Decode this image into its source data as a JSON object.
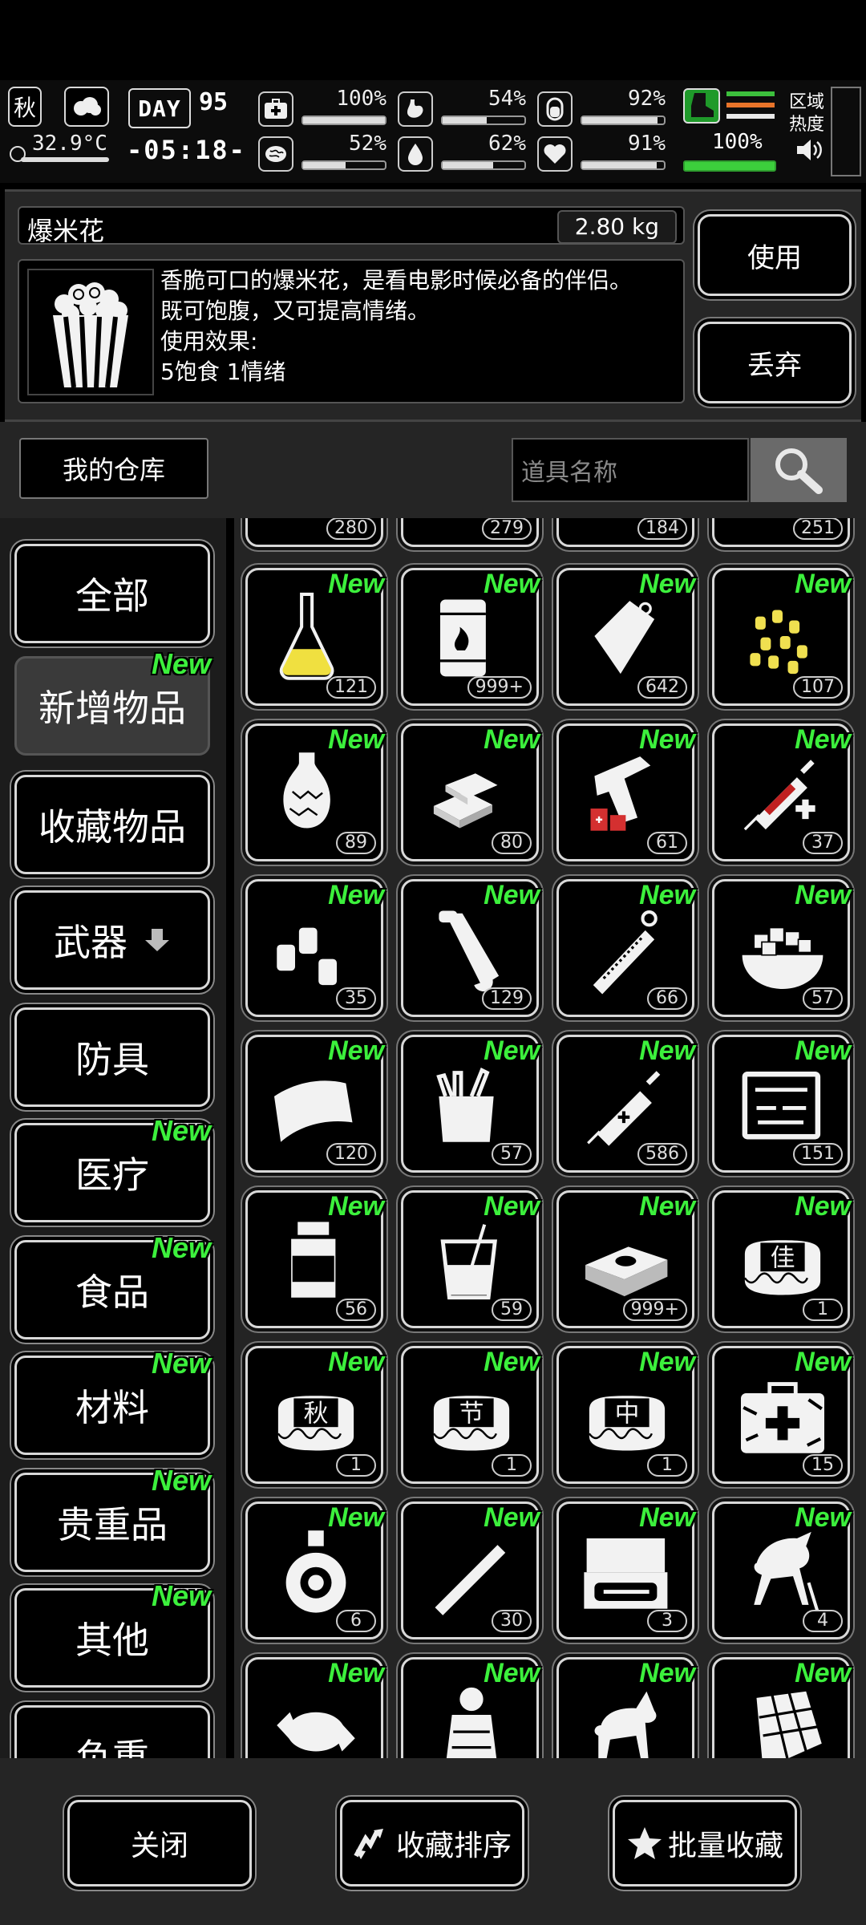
{
  "status_bar": {
    "season": "秋",
    "temperature": "32.9°C",
    "day_label": "DAY",
    "day_number": "95",
    "time": "-05:18-",
    "stats": [
      {
        "name": "health",
        "value": "100%",
        "level": 1.0
      },
      {
        "name": "hunger",
        "value": "54%",
        "level": 0.54
      },
      {
        "name": "energy",
        "value": "92%",
        "level": 0.92
      },
      {
        "name": "mind",
        "value": "52%",
        "level": 0.52
      },
      {
        "name": "thirst",
        "value": "62%",
        "level": 0.62
      },
      {
        "name": "mood",
        "value": "91%",
        "level": 0.91
      }
    ],
    "stamina_value": "100%",
    "stamina_level": 1.0,
    "heat_label": "区域\n热度"
  },
  "detail": {
    "item_name": "爆米花",
    "weight": "2.80 kg",
    "description_line1": "香脆可口的爆米花，是看电影时候必备的伴侣。",
    "description_line2": "既可饱腹，又可提高情绪。",
    "effect_label": "使用效果:",
    "effect_value": "5饱食 1情绪",
    "use_label": "使用",
    "discard_label": "丢弃"
  },
  "warehouse": {
    "title": "我的仓库",
    "search_placeholder": "道具名称"
  },
  "new_badge": "New",
  "categories": [
    {
      "label": "全部",
      "new": false
    },
    {
      "label": "新增物品",
      "new": true
    },
    {
      "label": "收藏物品",
      "new": false
    },
    {
      "label": "武器",
      "new": false
    },
    {
      "label": "防具",
      "new": false
    },
    {
      "label": "医疗",
      "new": true
    },
    {
      "label": "食品",
      "new": true
    },
    {
      "label": "材料",
      "new": true
    },
    {
      "label": "贵重品",
      "new": true
    },
    {
      "label": "其他",
      "new": true
    },
    {
      "label": "负重",
      "new": false
    }
  ],
  "partial_top_counts": [
    "280",
    "279",
    "184",
    "251"
  ],
  "items": [
    {
      "icon": "flask-icon",
      "count": "121"
    },
    {
      "icon": "oil-barrel-icon",
      "count": "999+"
    },
    {
      "icon": "plastic-bag-icon",
      "count": "642"
    },
    {
      "icon": "corn-kernels-icon",
      "count": "107"
    },
    {
      "icon": "vase-icon",
      "count": "89"
    },
    {
      "icon": "gold-bars-icon",
      "count": "80"
    },
    {
      "icon": "flare-gun-icon",
      "count": "61"
    },
    {
      "icon": "adrenaline-syringe-icon",
      "count": "37"
    },
    {
      "icon": "canisters-icon",
      "count": "35"
    },
    {
      "icon": "scroll-icon",
      "count": "129"
    },
    {
      "icon": "hanging-scale-icon",
      "count": "66"
    },
    {
      "icon": "sugar-bowl-icon",
      "count": "57"
    },
    {
      "icon": "cloth-icon",
      "count": "120"
    },
    {
      "icon": "tool-bag-icon",
      "count": "57"
    },
    {
      "icon": "syringe-icon",
      "count": "586"
    },
    {
      "icon": "tool-case-icon",
      "count": "151"
    },
    {
      "icon": "bottle-icon",
      "count": "56"
    },
    {
      "icon": "drink-cup-icon",
      "count": "59"
    },
    {
      "icon": "cash-stack-icon",
      "count": "999+"
    },
    {
      "icon": "mooncake-icon",
      "mark": "佳",
      "count": "1"
    },
    {
      "icon": "mooncake-icon",
      "mark": "秋",
      "count": "1"
    },
    {
      "icon": "mooncake-icon",
      "mark": "节",
      "count": "1"
    },
    {
      "icon": "mooncake-icon",
      "mark": "中",
      "count": "1"
    },
    {
      "icon": "medkit-icon",
      "count": "15"
    },
    {
      "icon": "liquor-bottle-icon",
      "count": "6"
    },
    {
      "icon": "cigarette-icon",
      "count": "30"
    },
    {
      "icon": "jewelry-box-icon",
      "count": "3"
    },
    {
      "icon": "horse-statue-icon",
      "count": "4"
    },
    {
      "icon": "candy-icon",
      "count": ""
    },
    {
      "icon": "terracotta-warrior-icon",
      "count": ""
    },
    {
      "icon": "tang-horse-icon",
      "count": ""
    },
    {
      "icon": "chocolate-icon",
      "count": ""
    }
  ],
  "bottom_bar": {
    "close_label": "关闭",
    "sort_label": "收藏排序",
    "batch_label": "批量收藏"
  }
}
